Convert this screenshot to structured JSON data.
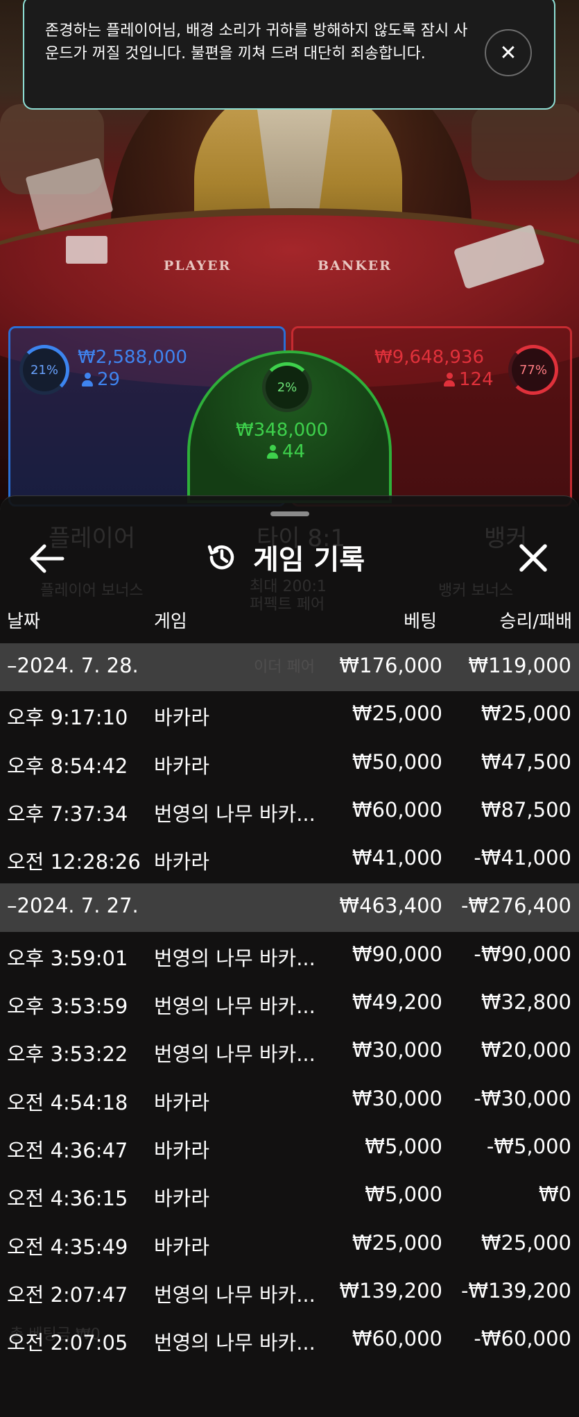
{
  "notification": {
    "message": "존경하는 플레이어님, 배경 소리가 귀하를 방해하지 않도록 잠시 사운드가 꺼질 것입니다. 불편을 끼쳐 드려 대단히 죄송합니다.",
    "close_glyph": "✕"
  },
  "table": {
    "player_label": "PLAYER",
    "banker_label": "BANKER"
  },
  "bets": {
    "player": {
      "percent": "21%",
      "amount": "₩2,588,000",
      "count": "29",
      "color": "#3f84ef"
    },
    "tie": {
      "percent": "2%",
      "amount": "₩348,000",
      "count": "44",
      "color": "#3ed14c"
    },
    "banker": {
      "percent": "77%",
      "amount": "₩9,648,936",
      "count": "124",
      "color": "#e0313b"
    }
  },
  "history": {
    "title": "게임 기록",
    "columns": {
      "date": "날짜",
      "game": "게임",
      "bet": "베팅",
      "winloss": "승리/패배"
    },
    "rows": [
      {
        "type": "group",
        "date": "–2024. 7. 28.",
        "game": "",
        "bet": "₩176,000",
        "winloss": "₩119,000"
      },
      {
        "type": "item",
        "date": "오후 9:17:10",
        "game": "바카라",
        "bet": "₩25,000",
        "winloss": "₩25,000"
      },
      {
        "type": "item",
        "date": "오후 8:54:42",
        "game": "바카라",
        "bet": "₩50,000",
        "winloss": "₩47,500"
      },
      {
        "type": "item",
        "date": "오후 7:37:34",
        "game": "번영의 나무 바카...",
        "bet": "₩60,000",
        "winloss": "₩87,500"
      },
      {
        "type": "item",
        "date": "오전 12:28:26",
        "game": "바카라",
        "bet": "₩41,000",
        "winloss": "-₩41,000"
      },
      {
        "type": "group",
        "date": "–2024. 7. 27.",
        "game": "",
        "bet": "₩463,400",
        "winloss": "-₩276,400"
      },
      {
        "type": "item",
        "date": "오후 3:59:01",
        "game": "번영의 나무 바카...",
        "bet": "₩90,000",
        "winloss": "-₩90,000"
      },
      {
        "type": "item",
        "date": "오후 3:53:59",
        "game": "번영의 나무 바카...",
        "bet": "₩49,200",
        "winloss": "₩32,800"
      },
      {
        "type": "item",
        "date": "오후 3:53:22",
        "game": "번영의 나무 바카...",
        "bet": "₩30,000",
        "winloss": "₩20,000"
      },
      {
        "type": "item",
        "date": "오전 4:54:18",
        "game": "바카라",
        "bet": "₩30,000",
        "winloss": "-₩30,000"
      },
      {
        "type": "item",
        "date": "오전 4:36:47",
        "game": "바카라",
        "bet": "₩5,000",
        "winloss": "-₩5,000"
      },
      {
        "type": "item",
        "date": "오전 4:36:15",
        "game": "바카라",
        "bet": "₩5,000",
        "winloss": "₩0"
      },
      {
        "type": "item",
        "date": "오전 4:35:49",
        "game": "바카라",
        "bet": "₩25,000",
        "winloss": "₩25,000"
      },
      {
        "type": "item",
        "date": "오전 2:07:47",
        "game": "번영의 나무 바카...",
        "bet": "₩139,200",
        "winloss": "-₩139,200"
      },
      {
        "type": "item",
        "date": "오전 2:07:05",
        "game": "번영의 나무 바카...",
        "bet": "₩60,000",
        "winloss": "-₩60,000"
      }
    ]
  },
  "background_game": {
    "tab_player": "플레이어",
    "tab_tie": "타이 8:1",
    "tab_banker": "뱅커",
    "player_bonus": "플레이어 보너스",
    "banker_bonus": "뱅커 보너스",
    "perfect_pair": "퍼펙트 페어",
    "perfect_pair_odds": "최대 200:1",
    "either_pair": "이더 페어",
    "total_bet": "총 베팅금 ₩0"
  },
  "icons": {
    "back": "arrow-left-icon",
    "history": "history-clock-icon",
    "close": "close-icon",
    "notice_close": "close-icon"
  }
}
